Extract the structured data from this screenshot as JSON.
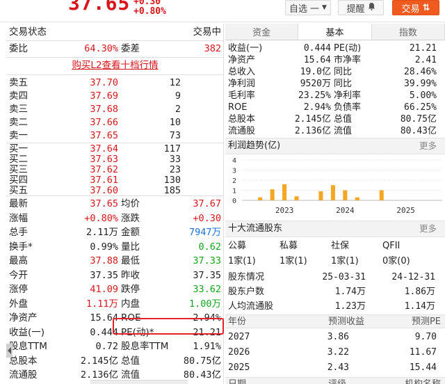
{
  "top": {
    "price": "37.65",
    "change": "+0.30",
    "change_pct": "+0.80%",
    "watch_label": "自选",
    "watch_suffix": "一",
    "remind_label": "提醒",
    "trade_label": "交易",
    "trade_icon": "⇅"
  },
  "left": {
    "status_label": "交易状态",
    "status_value": "交易中",
    "weibi_label": "委比",
    "weibi_value": "64.30%",
    "weicha_label": "委差",
    "weicha_value": "382",
    "l2_link": "购买L2查看十档行情",
    "asks": [
      {
        "label": "卖五",
        "price": "37.70",
        "vol": "12"
      },
      {
        "label": "卖四",
        "price": "37.69",
        "vol": "9"
      },
      {
        "label": "卖三",
        "price": "37.68",
        "vol": "2"
      },
      {
        "label": "卖二",
        "price": "37.66",
        "vol": "10"
      },
      {
        "label": "卖一",
        "price": "37.65",
        "vol": "73"
      }
    ],
    "bids": [
      {
        "label": "买一",
        "price": "37.64",
        "vol": "117"
      },
      {
        "label": "买二",
        "price": "37.63",
        "vol": "33"
      },
      {
        "label": "买三",
        "price": "37.62",
        "vol": "23"
      },
      {
        "label": "买四",
        "price": "37.61",
        "vol": "130"
      },
      {
        "label": "买五",
        "price": "37.60",
        "vol": "185"
      }
    ],
    "stats": [
      {
        "l1": "最新",
        "v1": "37.65",
        "c1": "red",
        "l2": "均价",
        "v2": "37.67",
        "c2": "red"
      },
      {
        "l1": "涨幅",
        "v1": "+0.80%",
        "c1": "red",
        "l2": "涨跌",
        "v2": "+0.30",
        "c2": "red"
      },
      {
        "l1": "总手",
        "v1": "2.11万",
        "c1": "",
        "l2": "金额",
        "v2": "7947万",
        "c2": "blue"
      },
      {
        "l1": "换手*",
        "v1": "0.99%",
        "c1": "",
        "l2": "量比",
        "v2": "0.62",
        "c2": "green"
      },
      {
        "l1": "最高",
        "v1": "37.88",
        "c1": "red",
        "l2": "最低",
        "v2": "37.33",
        "c2": "green"
      },
      {
        "l1": "今开",
        "v1": "37.35",
        "c1": "",
        "l2": "昨收",
        "v2": "37.35",
        "c2": ""
      },
      {
        "l1": "涨停",
        "v1": "41.09",
        "c1": "red",
        "l2": "跌停",
        "v2": "33.62",
        "c2": "green"
      },
      {
        "l1": "外盘",
        "v1": "1.11万",
        "c1": "red",
        "l2": "内盘",
        "v2": "1.00万",
        "c2": "green"
      },
      {
        "l1": "净资产",
        "v1": "15.64",
        "c1": "",
        "l2": "ROE",
        "v2": "2.94%",
        "c2": ""
      },
      {
        "l1": "收益(一)",
        "v1": "0.444",
        "c1": "",
        "l2": "PE(动)*",
        "v2": "21.21",
        "c2": ""
      },
      {
        "l1": "股息TTM",
        "v1": "0.72",
        "c1": "",
        "l2": "股息率TTM",
        "v2": "1.91%",
        "c2": ""
      },
      {
        "l1": "总股本",
        "v1": "2.145亿",
        "c1": "",
        "l2": "总值",
        "v2": "80.75亿",
        "c2": ""
      },
      {
        "l1": "流通股",
        "v1": "2.136亿",
        "c1": "",
        "l2": "流值",
        "v2": "80.43亿",
        "c2": ""
      }
    ]
  },
  "right": {
    "tabs": [
      "资金",
      "基本",
      "指数"
    ],
    "active_tab": "基本",
    "fundamentals": [
      {
        "l1": "收益(一)",
        "v1": "0.444",
        "l2": "PE(动)",
        "v2": "21.21"
      },
      {
        "l1": "净资产",
        "v1": "15.64",
        "l2": "市净率",
        "v2": "2.41"
      },
      {
        "l1": "总收入",
        "v1": "19.0亿",
        "l2": "同比",
        "v2": "28.46%"
      },
      {
        "l1": "净利润",
        "v1": "9520万",
        "l2": "同比",
        "v2": "39.99%"
      },
      {
        "l1": "毛利率",
        "v1": "23.25%",
        "l2": "净利率",
        "v2": "5.00%"
      },
      {
        "l1": "ROE",
        "v1": "2.94%",
        "l2": "负债率",
        "v2": "66.25%"
      },
      {
        "l1": "总股本",
        "v1": "2.145亿",
        "l2": "总值",
        "v2": "80.75亿"
      },
      {
        "l1": "流通股",
        "v1": "2.136亿",
        "l2": "流值",
        "v2": "80.43亿"
      }
    ],
    "profit_title": "利润趋势(亿)",
    "more_label": "更多",
    "holders_title": "十大流通股东",
    "holders_head": [
      "公募",
      "私募",
      "社保",
      "QFII"
    ],
    "holders_vals": [
      "1家(1)",
      "1家(1)",
      "1家(1)",
      "0家(0)"
    ],
    "holders_rows": [
      {
        "label": "股东情况",
        "v1": "25-03-31",
        "v2": "24-12-31"
      },
      {
        "label": "股东户数",
        "v1": "1.74万",
        "v2": "1.86万"
      },
      {
        "label": "人均流通股",
        "v1": "1.23万",
        "v2": "1.14万"
      }
    ],
    "forecast_head": [
      "年份",
      "预测收益",
      "预测PE"
    ],
    "forecast_rows": [
      {
        "year": "2027",
        "eps": "3.86",
        "pe": "9.70"
      },
      {
        "year": "2026",
        "eps": "3.22",
        "pe": "11.67"
      },
      {
        "year": "2025",
        "eps": "2.43",
        "pe": "15.44"
      }
    ],
    "rating_head": [
      "日期",
      "评级",
      "机构名称"
    ]
  },
  "chart_data": {
    "type": "bar",
    "title": "利润趋势(亿)",
    "xlabel": "",
    "ylabel": "",
    "ylim": [
      0,
      4
    ],
    "yticks": [
      "0",
      "1",
      "2",
      "3",
      "4"
    ],
    "xticks": [
      "2023",
      "2024",
      "2025"
    ],
    "x": [
      2022.6,
      2022.8,
      2023.0,
      2023.2,
      2023.6,
      2023.8,
      2024.0,
      2024.2,
      2024.6
    ],
    "values": [
      0.3,
      1.1,
      1.6,
      0.4,
      0.9,
      1.5,
      1.0,
      0.3,
      1.0
    ],
    "color": "#f5a623"
  }
}
